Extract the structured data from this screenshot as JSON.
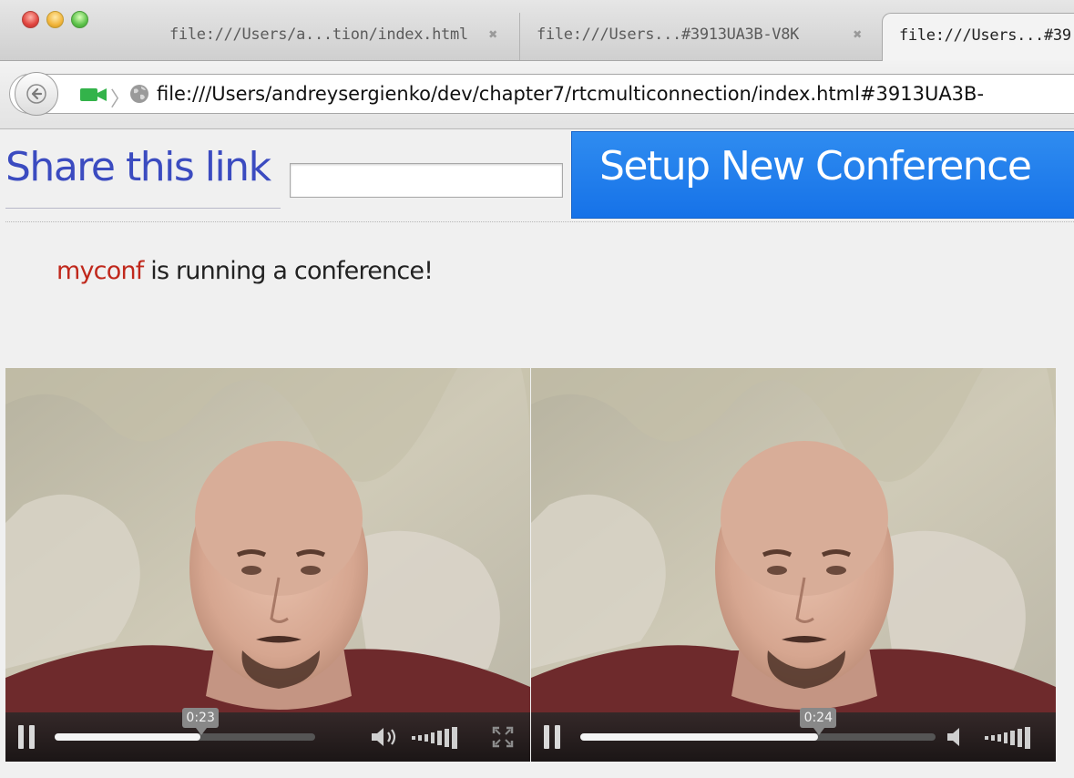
{
  "window": {
    "tabs": [
      {
        "label": "file:///Users/a...tion/index.html",
        "close": "✖"
      },
      {
        "label": "file:///Users...#3913UA3B-V8K",
        "close": "✖"
      },
      {
        "label": "file:///Users...#39"
      }
    ]
  },
  "address_bar": {
    "url": "file:///Users/andreysergienko/dev/chapter7/rtcmulticonnection/index.html#3913UA3B-"
  },
  "page": {
    "share_title": "Share this link",
    "share_input_value": "",
    "setup_button": "Setup New Conference",
    "status": {
      "host": "myconf",
      "message": " is running a conference!"
    }
  },
  "videos": [
    {
      "state": "playing",
      "time": "0:23",
      "progress": 0.56,
      "volume_icon": "speaker-on-icon",
      "volume_level": 1.0,
      "fullscreen": true
    },
    {
      "state": "playing",
      "time": "0:24",
      "progress": 0.67,
      "volume_icon": "speaker-icon",
      "volume_level": 1.0,
      "fullscreen": false
    }
  ],
  "colors": {
    "link_title": "#3b4bc0",
    "button_bg": "#1e7ef0",
    "host_name": "#c0281c"
  }
}
